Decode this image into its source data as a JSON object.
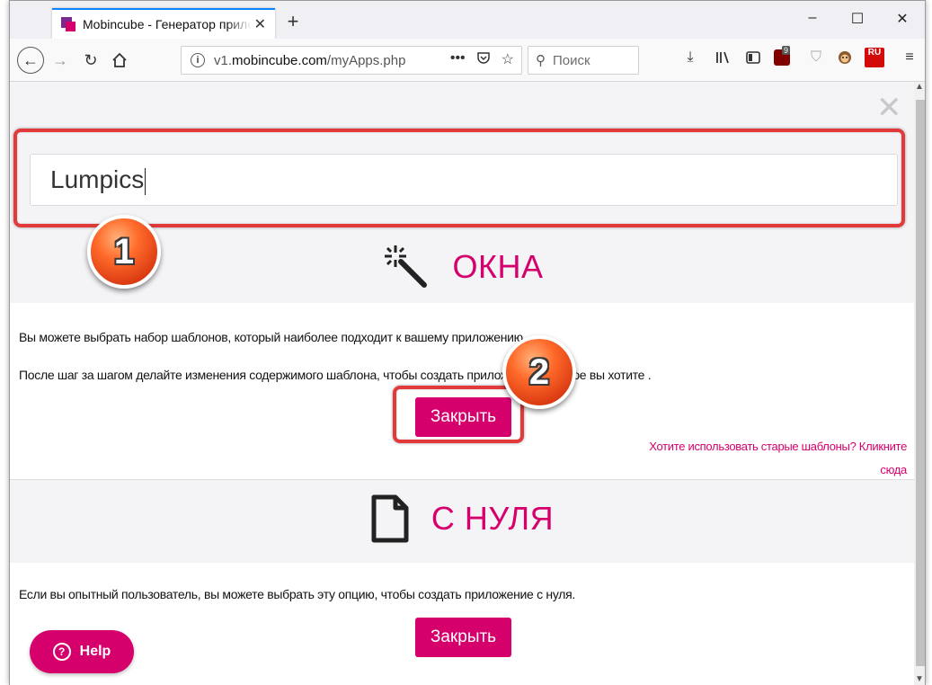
{
  "browser": {
    "tab_title": "Mobincube - Генератор прилож",
    "tab_close": "✕",
    "new_tab": "+",
    "minimize": "–",
    "maximize": "☐",
    "close": "✕",
    "url_prefix": "v1.",
    "url_domain": "mobincube.com",
    "url_path": "/myApps.php",
    "search_placeholder": "Поиск",
    "ext_badge_count": "9",
    "ext_ru_label": "RU",
    "icons": [
      "back-icon",
      "forward-icon",
      "reload-icon",
      "home-icon",
      "info-icon",
      "page-actions-icon",
      "pocket-icon",
      "bookmark-star-icon",
      "search-icon",
      "downloads-icon",
      "library-icon",
      "sidebar-icon",
      "ublock-icon",
      "shield-icon",
      "monkey-icon",
      "ru-extension-icon",
      "menu-icon"
    ]
  },
  "page": {
    "app_name_value": "Lumpics",
    "section1": {
      "title": "ОКНА",
      "line1": "Вы можете выбрать набор шаблонов, который наиболее подходит к вашему приложению.",
      "line2": "После шаг за шагом делайте изменения содержимого шаблона, чтобы создать приложение, которое вы хотите .",
      "button": "Закрыть",
      "old_templates_link": "Хотите использовать старые шаблоны? Кликните сюда"
    },
    "section2": {
      "title": "С НУЛЯ",
      "line1": "Если вы опытный пользователь, вы можете выбрать эту опцию, чтобы создать приложение с нуля.",
      "button": "Закрыть"
    },
    "help_label": "Help",
    "help_icon_glyph": "?"
  },
  "annotations": {
    "marker1": "1",
    "marker2": "2",
    "highlight_color": "#e23a3a"
  },
  "colors": {
    "accent": "#d6006d",
    "tab_border": "#0a84ff"
  }
}
